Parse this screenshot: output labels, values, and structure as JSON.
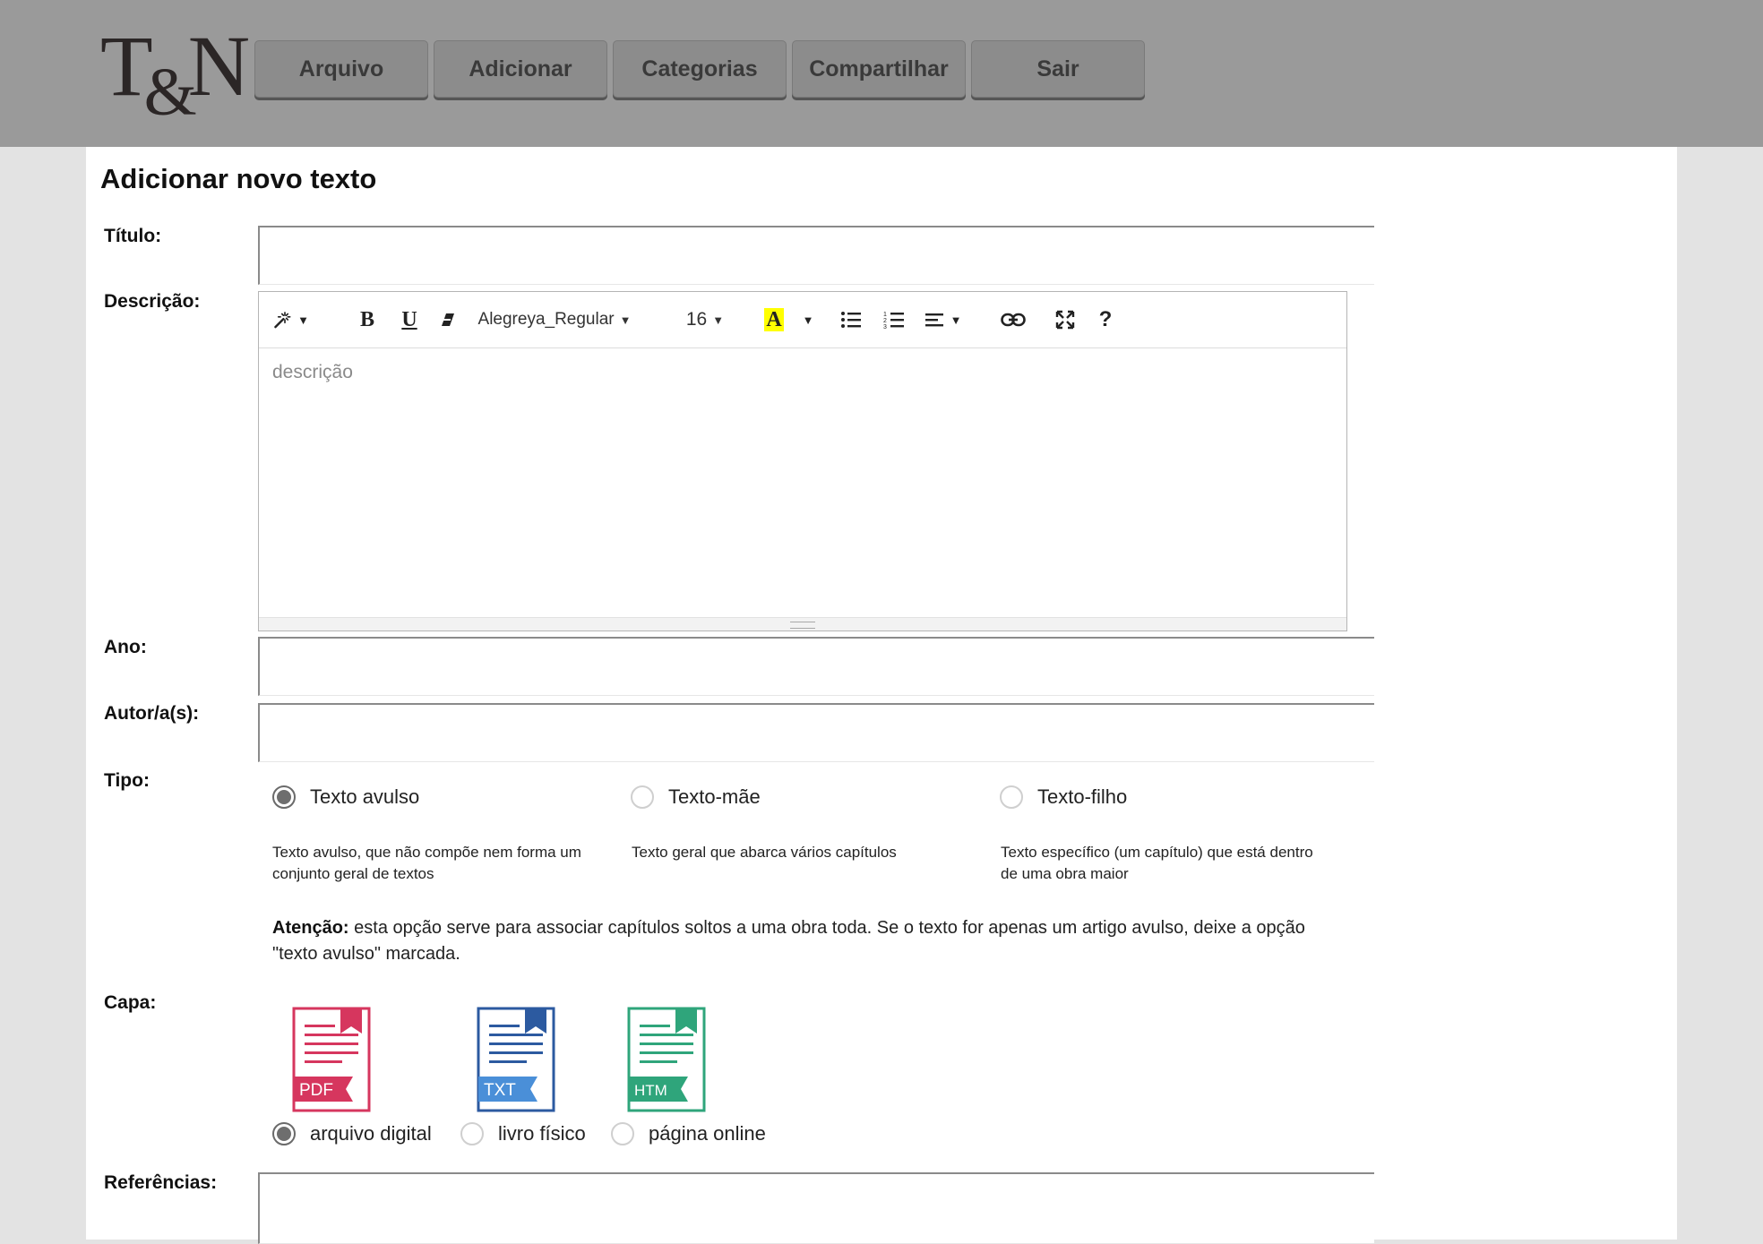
{
  "header": {
    "logo_left": "T",
    "logo_amp": "&",
    "logo_right": "N",
    "nav": [
      "Arquivo",
      "Adicionar",
      "Categorias",
      "Compartilhar",
      "Sair"
    ]
  },
  "page": {
    "title": "Adicionar novo texto"
  },
  "form": {
    "titulo_label": "Título:",
    "descricao_label": "Descrição:",
    "ano_label": "Ano:",
    "autores_label": "Autor/a(s):",
    "tipo_label": "Tipo:",
    "capa_label": "Capa:",
    "referencias_label": "Referências:"
  },
  "editor": {
    "font_name": "Alegreya_Regular",
    "font_size": "16",
    "placeholder": "descrição",
    "icons": [
      "magic-icon",
      "bold-icon",
      "underline-icon",
      "eraser-icon",
      "text-color-icon",
      "unordered-list-icon",
      "ordered-list-icon",
      "align-icon",
      "link-icon",
      "fullscreen-icon",
      "help-icon"
    ],
    "highlight_color": "#ffff00"
  },
  "tipo": {
    "options": [
      {
        "label": "Texto avulso",
        "description": "Texto avulso, que não compõe nem forma um conjunto geral de textos",
        "checked": true
      },
      {
        "label": "Texto-mãe",
        "description": "Texto geral que abarca vários capítulos",
        "checked": false
      },
      {
        "label": "Texto-filho",
        "description": "Texto específico (um capítulo) que está dentro de uma obra maior",
        "checked": false
      }
    ],
    "attention_label": "Atenção:",
    "attention_text": " esta opção serve para associar capítulos soltos a uma obra toda. Se o texto for apenas um artigo avulso, deixe a opção \"texto avulso\" marcada."
  },
  "capa": {
    "icons": [
      {
        "ext": "PDF",
        "color": "#d6365e"
      },
      {
        "ext": "TXT",
        "color": "#2c5aa0"
      },
      {
        "ext": "HTM",
        "color": "#2fa57b"
      }
    ],
    "options": [
      {
        "label": "arquivo digital",
        "checked": true
      },
      {
        "label": "livro físico",
        "checked": false
      },
      {
        "label": "página online",
        "checked": false
      }
    ]
  },
  "colors": {
    "header_bg": "#9a9a9a",
    "page_bg": "#e3e3e3",
    "nav_btn": "#8c8c8c"
  }
}
